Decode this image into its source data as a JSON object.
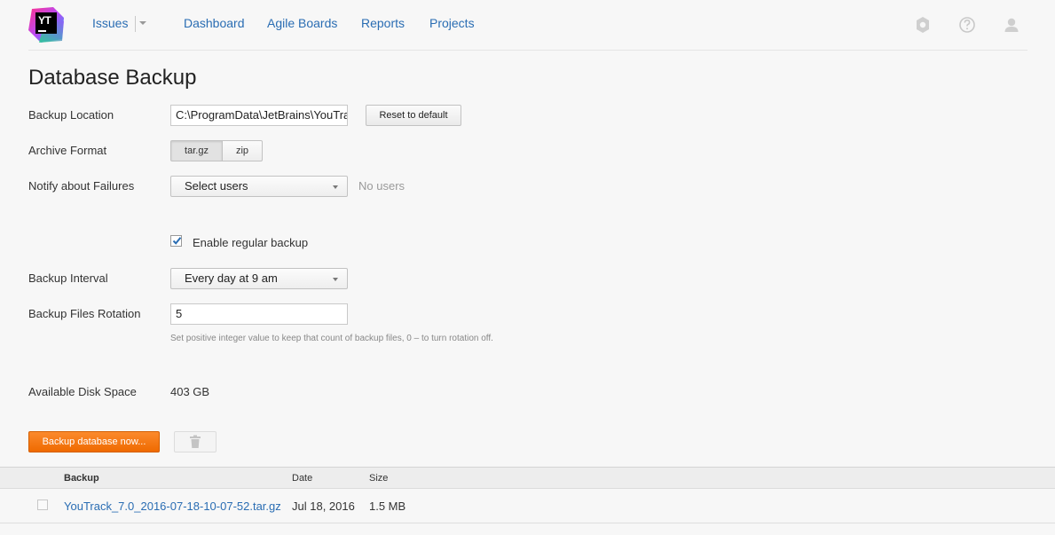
{
  "header": {
    "logo_text": "YT",
    "nav": {
      "issues": "Issues",
      "dashboard": "Dashboard",
      "agile_boards": "Agile Boards",
      "reports": "Reports",
      "projects": "Projects"
    },
    "icons": [
      "settings-icon",
      "help-icon",
      "user-icon"
    ]
  },
  "page": {
    "title": "Database Backup"
  },
  "form": {
    "backup_location_label": "Backup Location",
    "backup_location_value": "C:\\ProgramData\\JetBrains\\YouTrack\\backups",
    "reset_button": "Reset to default",
    "archive_format_label": "Archive Format",
    "archive_formats": [
      "tar.gz",
      "zip"
    ],
    "archive_format_selected": "tar.gz",
    "notify_label": "Notify about Failures",
    "notify_select": "Select users",
    "notify_status": "No users",
    "enable_regular_label": "Enable regular backup",
    "enable_regular_checked": true,
    "interval_label": "Backup Interval",
    "interval_value": "Every day at 9 am",
    "rotation_label": "Backup Files Rotation",
    "rotation_value": "5",
    "rotation_hint": "Set positive integer value to keep that count of backup files, 0 – to turn rotation off.",
    "disk_space_label": "Available Disk Space",
    "disk_space_value": "403 GB",
    "backup_now_button": "Backup database now...",
    "delete_icon": "trash-icon"
  },
  "table": {
    "headers": {
      "backup": "Backup",
      "date": "Date",
      "size": "Size"
    },
    "rows": [
      {
        "name": "YouTrack_7.0_2016-07-18-10-07-52.tar.gz",
        "date": "Jul 18, 2016",
        "size": "1.5 MB",
        "checked": false
      }
    ]
  },
  "colors": {
    "link": "#2a6db3",
    "primary_button": "#f47a14",
    "background": "#f7f7f7"
  }
}
